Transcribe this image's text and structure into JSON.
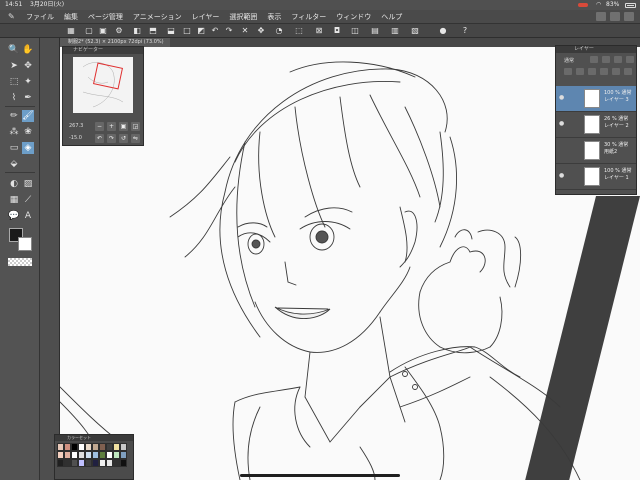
{
  "status_bar": {
    "time": "14:51",
    "date": "3月20日(火)",
    "battery": "83%"
  },
  "menu": [
    "ファイル",
    "編集",
    "ページ管理",
    "アニメーション",
    "レイヤー",
    "選択範囲",
    "表示",
    "フィルター",
    "ウィンドウ",
    "ヘルプ"
  ],
  "document_tab": {
    "title": "制服2* (52.3) × 2100px 72dpi (73.0%)"
  },
  "navigator": {
    "title": "ナビゲーター",
    "zoom": "267.3",
    "angle": "-15.0"
  },
  "layer_panel": {
    "title": "レイヤー",
    "blend_mode": "通常",
    "layers": [
      {
        "opacity": "100 %",
        "mode": "通常",
        "name": "レイヤー 3",
        "selected": true
      },
      {
        "opacity": "26 %",
        "mode": "通常",
        "name": "レイヤー 2",
        "selected": false
      },
      {
        "opacity": "30 %",
        "mode": "通常",
        "name": "用紙2",
        "selected": false
      },
      {
        "opacity": "100 %",
        "mode": "通常",
        "name": "レイヤー 1",
        "selected": false
      }
    ]
  },
  "palette": {
    "title": "カラーセット",
    "colors": [
      "#e8c8b8",
      "#d09080",
      "#000000",
      "#ffffff",
      "#e8d8c8",
      "#c0a890",
      "#806050",
      "#404040",
      "#f0e0a0",
      "#c8c8c8",
      "#f4d0c0",
      "#e0b0a0",
      "#ffffff",
      "#e0e0e0",
      "#d0e0f0",
      "#a0c0e0",
      "#608040",
      "#ffffff",
      "#c0e8c0",
      "#80a0c0",
      "#202020",
      "#303030",
      "#505050",
      "#c0c0ff",
      "#404040",
      "#202040",
      "#f0f0f0",
      "#e8e8e8",
      "#303030",
      "#101010"
    ]
  },
  "colors": {
    "accent": "#5e86b0",
    "ui_dark": "#3e3e3e",
    "fg_color": "#1a1a1a",
    "bg_color": "#ffffff"
  }
}
